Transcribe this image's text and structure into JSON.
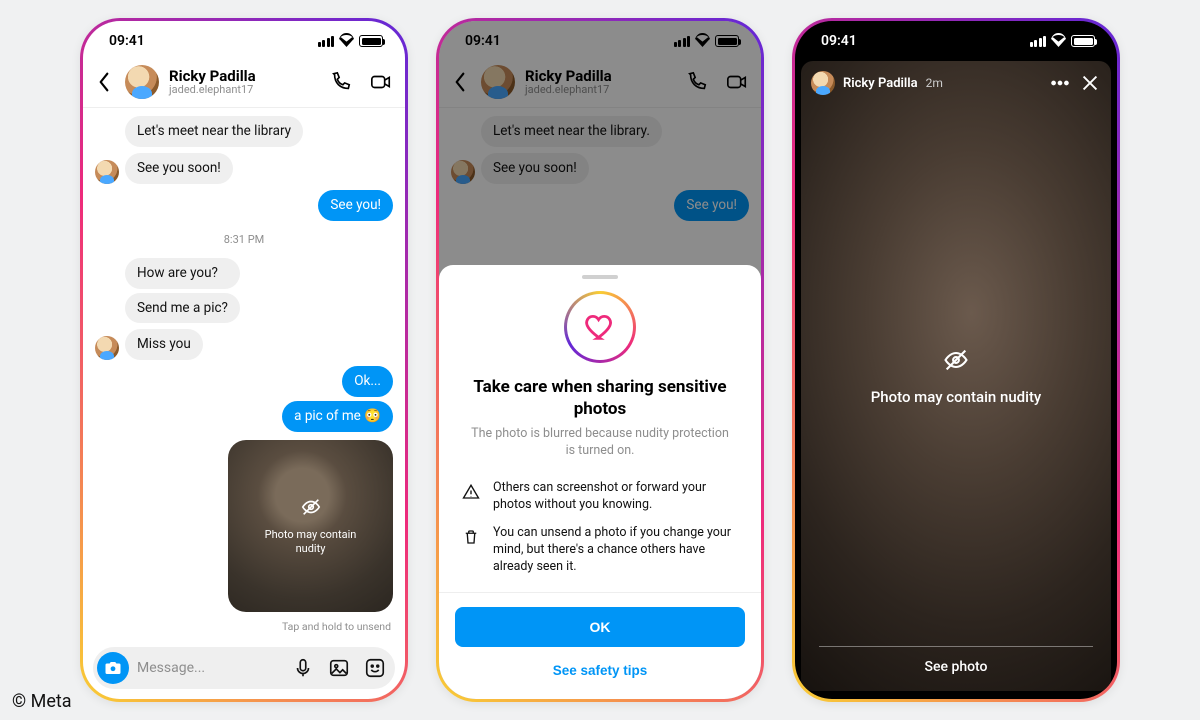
{
  "status": {
    "time": "09:41"
  },
  "header": {
    "name": "Ricky Padilla",
    "username": "jaded.elephant17"
  },
  "chat1": {
    "m1": "Let's meet near the library",
    "m2": "See you soon!",
    "m3": "See you!",
    "ts": "8:31 PM",
    "m4": "How are you?",
    "m5": "Send me a pic?",
    "m6": "Miss you",
    "m7": "Ok...",
    "m8": "a pic of me 😳",
    "blur": "Photo may contain nudity",
    "hint": "Tap and hold to unsend",
    "placeholder": "Message..."
  },
  "chat2": {
    "m1": "Let's meet near the library.",
    "m2": "See you soon!",
    "m3": "See you!"
  },
  "sheet": {
    "title": "Take care when sharing sensitive photos",
    "sub": "The photo is blurred because nudity protection is turned on.",
    "info1": "Others can screenshot or forward your photos without you knowing.",
    "info2": "You can unsend a photo if you change your mind, but there's a chance others have already seen it.",
    "ok": "OK",
    "link": "See safety tips"
  },
  "story": {
    "name": "Ricky Padilla",
    "age": "2m",
    "msg": "Photo may contain nudity",
    "cta": "See photo"
  },
  "copyright": "© Meta"
}
